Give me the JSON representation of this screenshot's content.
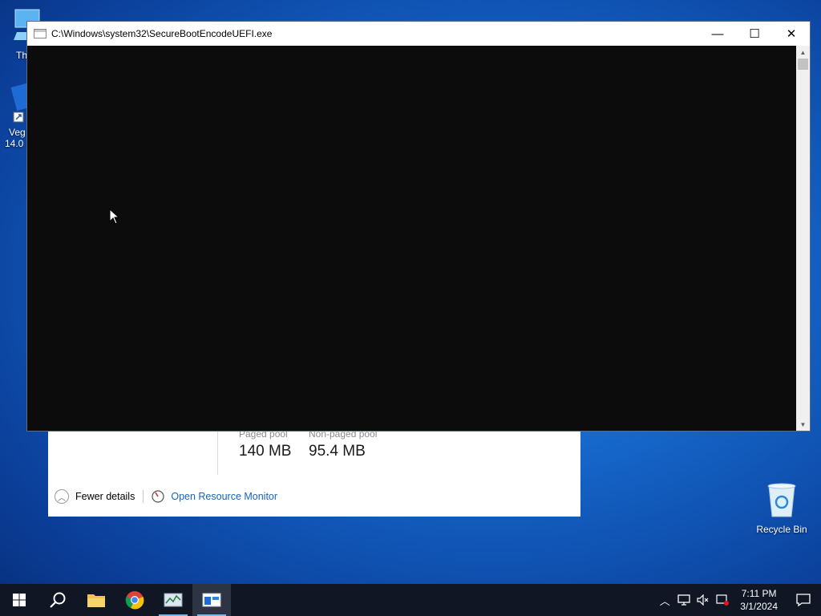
{
  "desktop": {
    "icons": [
      {
        "label": "Th",
        "icon": "this-pc-icon"
      },
      {
        "label": "Veg\n14.0 (",
        "icon": "vegas-shortcut-icon"
      },
      {
        "label": "Recycle Bin",
        "icon": "recycle-bin-icon"
      }
    ]
  },
  "task_manager": {
    "paged_pool_label": "Paged pool",
    "paged_pool_value": "140 MB",
    "nonpaged_pool_label": "Non-paged pool",
    "nonpaged_pool_value": "95.4 MB",
    "fewer_details": "Fewer details",
    "open_resource_monitor": "Open Resource Monitor"
  },
  "console": {
    "title": "C:\\Windows\\system32\\SecureBootEncodeUEFI.exe",
    "minimize": "—",
    "maximize": "☐",
    "close": "✕"
  },
  "taskbar": {
    "buttons": [
      "start-icon",
      "search-icon",
      "file-explorer-icon",
      "chrome-icon",
      "task-manager-icon",
      "console-app-icon"
    ],
    "clock_time": "7:11 PM",
    "clock_date": "3/1/2024"
  },
  "colors": {
    "link": "#1b62b5",
    "taskbar": "#101623",
    "console_bg": "#0c0c0c"
  }
}
